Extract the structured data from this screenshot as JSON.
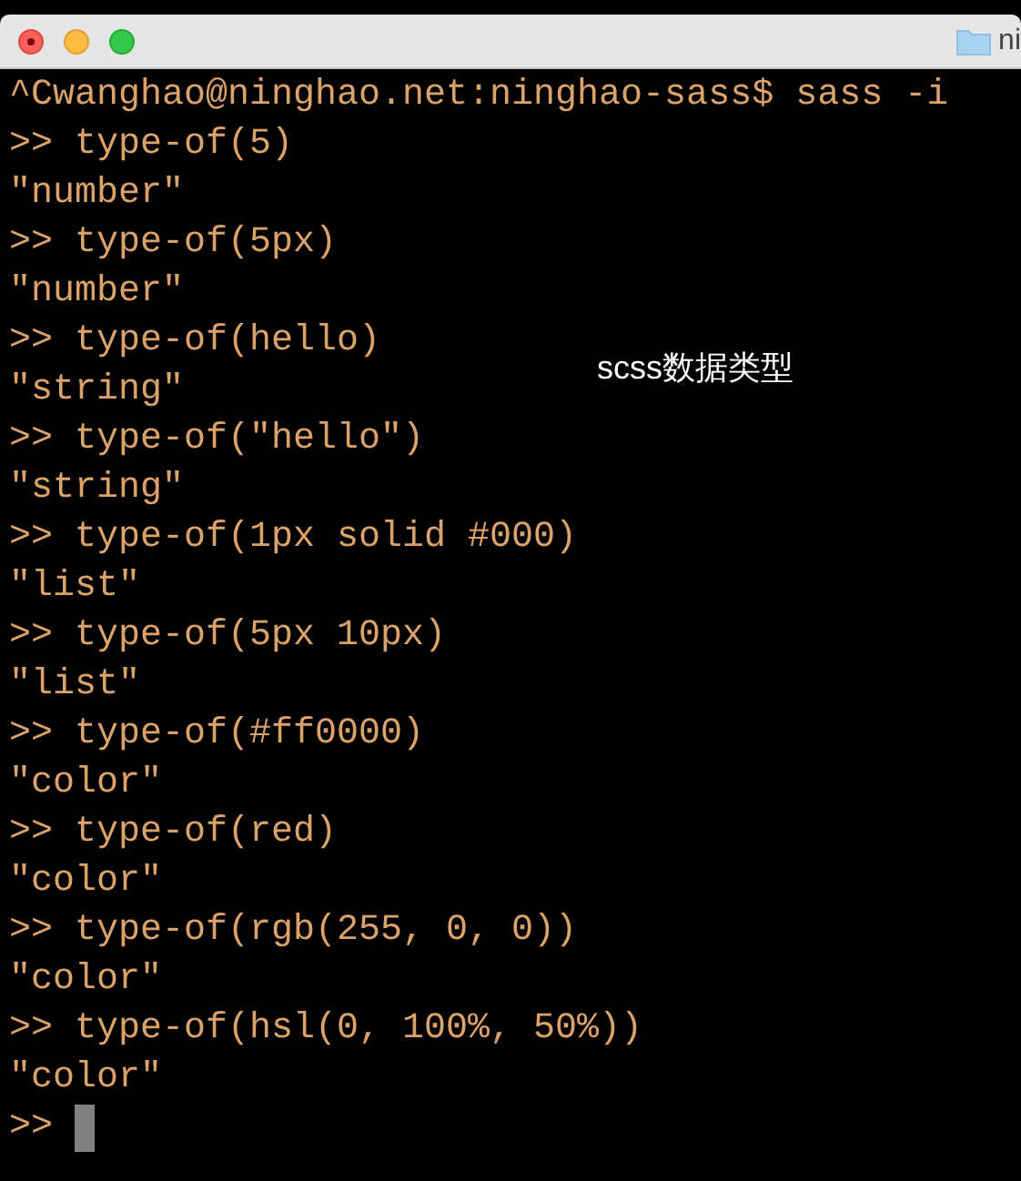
{
  "window": {
    "title": "ni"
  },
  "terminal": {
    "lines": [
      "^Cwanghao@ninghao.net:ninghao-sass$ sass -i",
      ">> type-of(5)",
      "\"number\"",
      ">> type-of(5px)",
      "\"number\"",
      ">> type-of(hello)",
      "\"string\"",
      ">> type-of(\"hello\")",
      "\"string\"",
      ">> type-of(1px solid #000)",
      "\"list\"",
      ">> type-of(5px 10px)",
      "\"list\"",
      ">> type-of(#ff0000)",
      "\"color\"",
      ">> type-of(red)",
      "\"color\"",
      ">> type-of(rgb(255, 0, 0))",
      "\"color\"",
      ">> type-of(hsl(0, 100%, 50%))",
      "\"color\""
    ],
    "prompt": ">>"
  },
  "caption": "scss数据类型"
}
